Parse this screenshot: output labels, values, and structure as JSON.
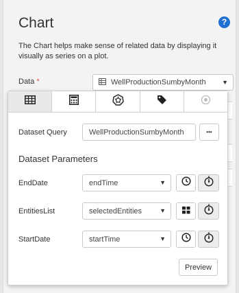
{
  "panel": {
    "title": "Chart",
    "help_icon": "?",
    "description": "The Chart helps make sense of related data by displaying it visually as series on a plot."
  },
  "data_field": {
    "label": "Data",
    "required_mark": "*",
    "value": "WellProductionSumbyMonth",
    "icon": "table-icon"
  },
  "popover": {
    "tabs": [
      {
        "icon": "table-icon",
        "active": true
      },
      {
        "icon": "calculator-icon",
        "active": false
      },
      {
        "icon": "kubernetes-icon",
        "active": false
      },
      {
        "icon": "tag-icon",
        "active": false
      },
      {
        "icon": "target-icon",
        "active": false,
        "disabled": true
      }
    ],
    "dataset_query": {
      "label": "Dataset Query",
      "value": "WellProductionSumbyMonth",
      "more_button": "•••"
    },
    "section_title": "Dataset Parameters",
    "params": [
      {
        "label": "EndDate",
        "value": "endTime",
        "button1_icon": "clock-icon",
        "button2_icon": "timer-icon"
      },
      {
        "label": "EntitiesList",
        "value": "selectedEntities",
        "button1_icon": "grid-icon",
        "button2_icon": "timer-icon"
      },
      {
        "label": "StartDate",
        "value": "startTime",
        "button1_icon": "clock-icon",
        "button2_icon": "timer-icon"
      }
    ],
    "preview_label": "Preview"
  }
}
